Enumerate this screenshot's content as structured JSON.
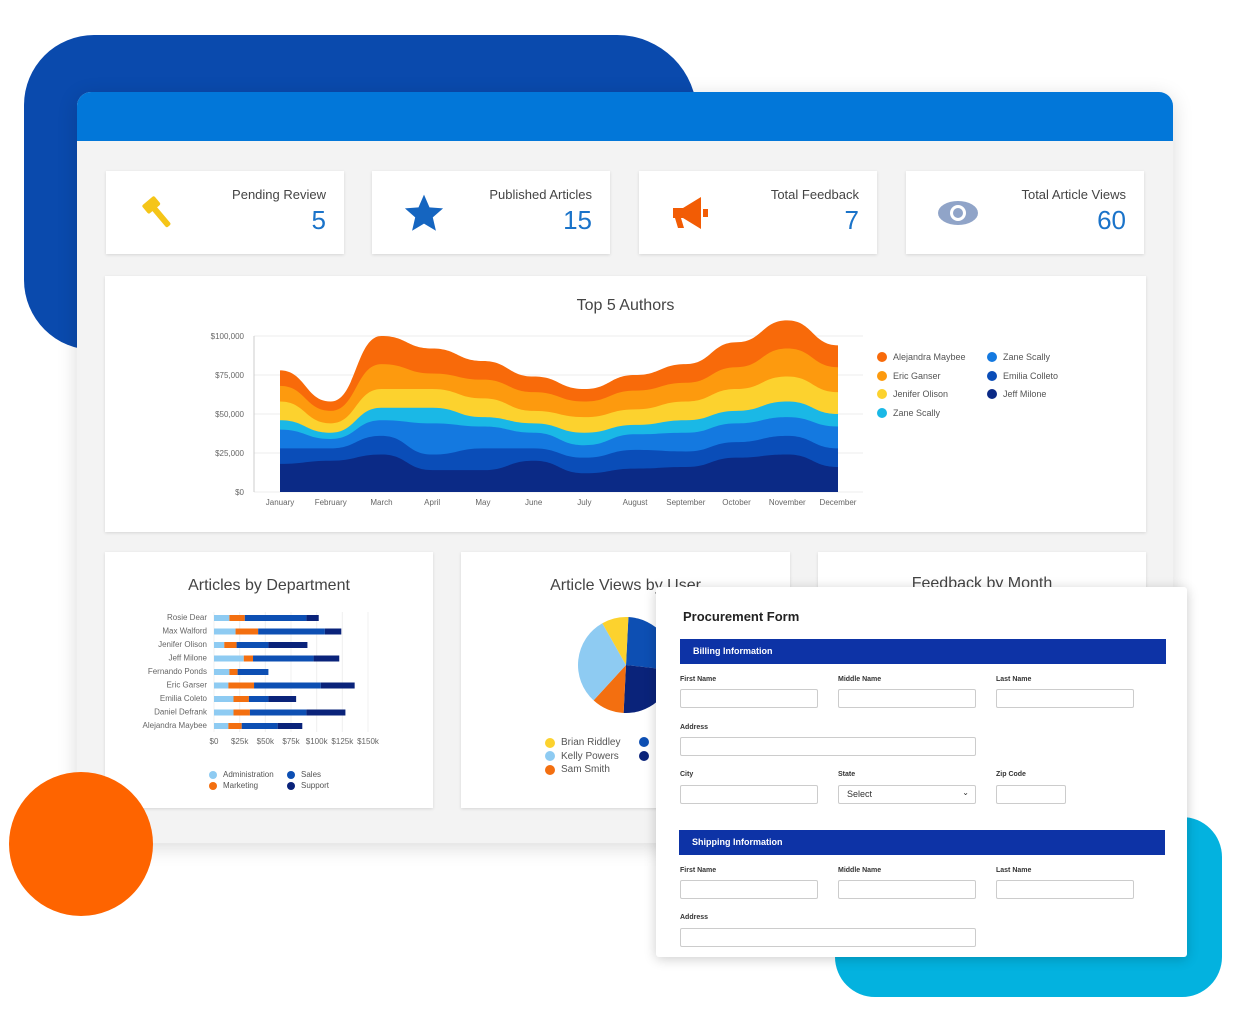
{
  "colors": {
    "brand_dark": "#0a4aad",
    "brand": "#0277d9",
    "accent_orange": "#fe6400",
    "accent_cyan": "#03b2df",
    "form_section": "#0d33a6"
  },
  "stats": [
    {
      "label": "Pending Review",
      "value": "5",
      "icon": "gavel-icon",
      "color": "#f5c518"
    },
    {
      "label": "Published Articles",
      "value": "15",
      "icon": "star-icon",
      "color": "#1565c0"
    },
    {
      "label": "Total Feedback",
      "value": "7",
      "icon": "megaphone-icon",
      "color": "#f25c05"
    },
    {
      "label": "Total Article Views",
      "value": "60",
      "icon": "eye-icon",
      "color": "#90a4c8"
    }
  ],
  "chart_data": [
    {
      "type": "area",
      "title": "Top 5 Authors",
      "stacked": true,
      "ylim": [
        0,
        100000
      ],
      "yticks": [
        "$0",
        "$25,000",
        "$50,000",
        "$75,000",
        "$100,000"
      ],
      "categories": [
        "January",
        "February",
        "March",
        "April",
        "May",
        "June",
        "July",
        "August",
        "September",
        "October",
        "November",
        "December"
      ],
      "legend_position": "right",
      "series": [
        {
          "name": "Jeff Milone",
          "color": "#0b2a86",
          "values": [
            18000,
            20000,
            24000,
            14000,
            14000,
            20000,
            12000,
            15000,
            16000,
            22000,
            24000,
            16000
          ]
        },
        {
          "name": "Emilia Colleto",
          "color": "#0a4db8",
          "values": [
            10000,
            8000,
            12000,
            10000,
            14000,
            8000,
            10000,
            12000,
            10000,
            10000,
            12000,
            12000
          ]
        },
        {
          "name": "Zane Scally",
          "color": "#1479e0",
          "values": [
            12000,
            6000,
            10000,
            20000,
            14000,
            10000,
            8000,
            10000,
            12000,
            12000,
            12000,
            14000
          ]
        },
        {
          "name": "Zane Scally",
          "color": "#1ab8e6",
          "values": [
            6000,
            4000,
            8000,
            10000,
            6000,
            6000,
            8000,
            6000,
            8000,
            8000,
            10000,
            8000
          ]
        },
        {
          "name": "Jenifer Olison",
          "color": "#fcd22e",
          "values": [
            12000,
            6000,
            12000,
            12000,
            12000,
            8000,
            10000,
            10000,
            12000,
            14000,
            16000,
            14000
          ]
        },
        {
          "name": "Eric Ganser",
          "color": "#fd9a0e",
          "values": [
            10000,
            8000,
            16000,
            10000,
            12000,
            12000,
            10000,
            12000,
            12000,
            14000,
            18000,
            16000
          ]
        },
        {
          "name": "Alejandra Maybee",
          "color": "#f86a0a",
          "values": [
            10000,
            6000,
            18000,
            16000,
            12000,
            10000,
            8000,
            10000,
            12000,
            16000,
            18000,
            14000
          ]
        }
      ]
    },
    {
      "type": "bar",
      "orientation": "horizontal",
      "stacked": true,
      "title": "Articles by Department",
      "xlim": [
        0,
        150000
      ],
      "xticks": [
        "$0",
        "$25k",
        "$50k",
        "$75k",
        "$100k",
        "$125k",
        "$150k"
      ],
      "categories": [
        "Rosie Dear",
        "Max Walford",
        "Jenifer Olison",
        "Jeff Milone",
        "Fernando Ponds",
        "Eric Garser",
        "Emilia Coleto",
        "Daniel Defrank",
        "Alejandra Maybee"
      ],
      "series": [
        {
          "name": "Administration",
          "color": "#8ecbf2",
          "values": [
            15,
            21,
            10,
            29,
            15,
            14,
            19,
            19,
            14
          ]
        },
        {
          "name": "Marketing",
          "color": "#f36f10",
          "values": [
            15,
            22,
            12,
            9,
            8,
            25,
            15,
            16,
            13
          ]
        },
        {
          "name": "Sales",
          "color": "#0d4fb3",
          "values": [
            60,
            65,
            31,
            59,
            30,
            65,
            19,
            55,
            35
          ]
        },
        {
          "name": "Support",
          "color": "#0a237a",
          "values": [
            12,
            16,
            38,
            25,
            0,
            33,
            27,
            38,
            24
          ]
        }
      ],
      "unit": "k"
    },
    {
      "type": "pie",
      "title": "Article Views by User",
      "slices": [
        {
          "name": "",
          "color": "#0d4fb3",
          "value": 26
        },
        {
          "name": "",
          "color": "#0a237a",
          "value": 24
        },
        {
          "name": "Sam Smith",
          "color": "#f36f10",
          "value": 11
        },
        {
          "name": "Kelly Powers",
          "color": "#8ecbf2",
          "value": 30
        },
        {
          "name": "Brian Riddley",
          "color": "#fcd22e",
          "value": 9
        }
      ]
    },
    {
      "type": "bar",
      "title": "Feedback by Month"
    }
  ],
  "form": {
    "title": "Procurement Form",
    "billing": {
      "header": "Billing Information",
      "first": "First Name",
      "middle": "Middle Name",
      "last": "Last Name",
      "address": "Address",
      "city": "City",
      "state": "State",
      "state_value": "Select",
      "zip": "Zip Code"
    },
    "shipping": {
      "header": "Shipping Information",
      "first": "First Name",
      "middle": "Middle Name",
      "last": "Last Name",
      "address": "Address"
    }
  }
}
